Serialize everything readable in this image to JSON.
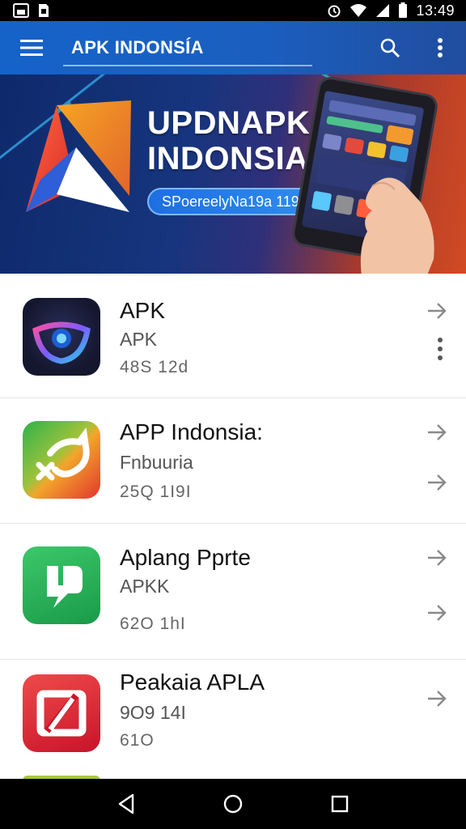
{
  "status_bar": {
    "time": "13:49",
    "icons": [
      "image-icon",
      "sim-icon",
      "alarm-icon",
      "wifi-icon",
      "signal-icon",
      "battery-icon"
    ]
  },
  "app_bar": {
    "title": "APK INDONSÍA",
    "actions": [
      "menu-icon",
      "search-icon",
      "more-vert-icon"
    ]
  },
  "banner": {
    "title_line1": "UPDNAPK",
    "title_line2": "INDONSIA",
    "pill_text": "SPoereelyNa19a 119",
    "carousel_dots": 4,
    "active_dot": 1
  },
  "apps": [
    {
      "name": "APK",
      "subtitle": "APK",
      "meta": "48S 12d",
      "extra": ""
    },
    {
      "name": "APP Indonsia:",
      "subtitle": "Fnbuuria",
      "meta": "25Q 1I9I",
      "extra": ""
    },
    {
      "name": "Aplang Pprte",
      "subtitle": "APKK",
      "meta": "62O  1hI",
      "extra": ""
    },
    {
      "name": "Peakaia APLA",
      "subtitle": "9O9  14I",
      "meta": "61O",
      "extra": ""
    }
  ],
  "colors": {
    "app_bar": "#1a5fc0",
    "accent_red": "#e23b2e",
    "accent_green": "#1faa4e"
  },
  "navigation": [
    "back-icon",
    "home-icon",
    "recents-icon"
  ]
}
